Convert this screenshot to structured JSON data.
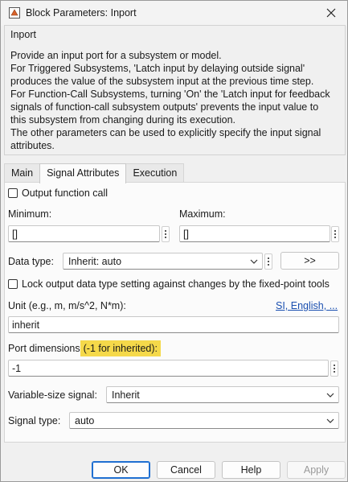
{
  "window": {
    "title": "Block Parameters: Inport"
  },
  "group": {
    "title": "Inport",
    "description": [
      "Provide an input port for a subsystem or model.",
      "For Triggered Subsystems, 'Latch input by delaying outside signal'",
      "produces the value of the subsystem input at the previous time step.",
      "For Function-Call Subsystems, turning 'On' the 'Latch input for feedback",
      "signals of function-call subsystem outputs' prevents the input value to",
      "this subsystem from changing during its execution.",
      "The other parameters can be used to explicitly specify the input signal",
      "attributes."
    ]
  },
  "tabs": [
    {
      "label": "Main",
      "active": false
    },
    {
      "label": "Signal Attributes",
      "active": true
    },
    {
      "label": "Execution",
      "active": false
    }
  ],
  "signal_attributes": {
    "output_function_call": {
      "label": "Output function call",
      "checked": false
    },
    "minimum": {
      "label": "Minimum:",
      "value": "[]"
    },
    "maximum": {
      "label": "Maximum:",
      "value": "[]"
    },
    "data_type": {
      "label": "Data type:",
      "value": "Inherit: auto",
      "assistant_label": ">>"
    },
    "lock_output": {
      "label": "Lock output data type setting against changes by the fixed-point tools",
      "checked": false
    },
    "unit": {
      "label": "Unit (e.g., m, m/s^2, N*m):",
      "link": "SI, English, ...",
      "value": "inherit"
    },
    "port_dimensions": {
      "label_prefix": "Port dimensions",
      "label_highlight": "(-1 for inherited):",
      "value": "-1"
    },
    "variable_size": {
      "label": "Variable-size signal:",
      "value": "Inherit"
    },
    "signal_type": {
      "label": "Signal type:",
      "value": "auto"
    }
  },
  "buttons": {
    "ok": "OK",
    "cancel": "Cancel",
    "help": "Help",
    "apply": "Apply"
  },
  "colors": {
    "highlight": "#f5d94a",
    "primary_border": "#1f6fd1",
    "link": "#1a4fb0"
  }
}
